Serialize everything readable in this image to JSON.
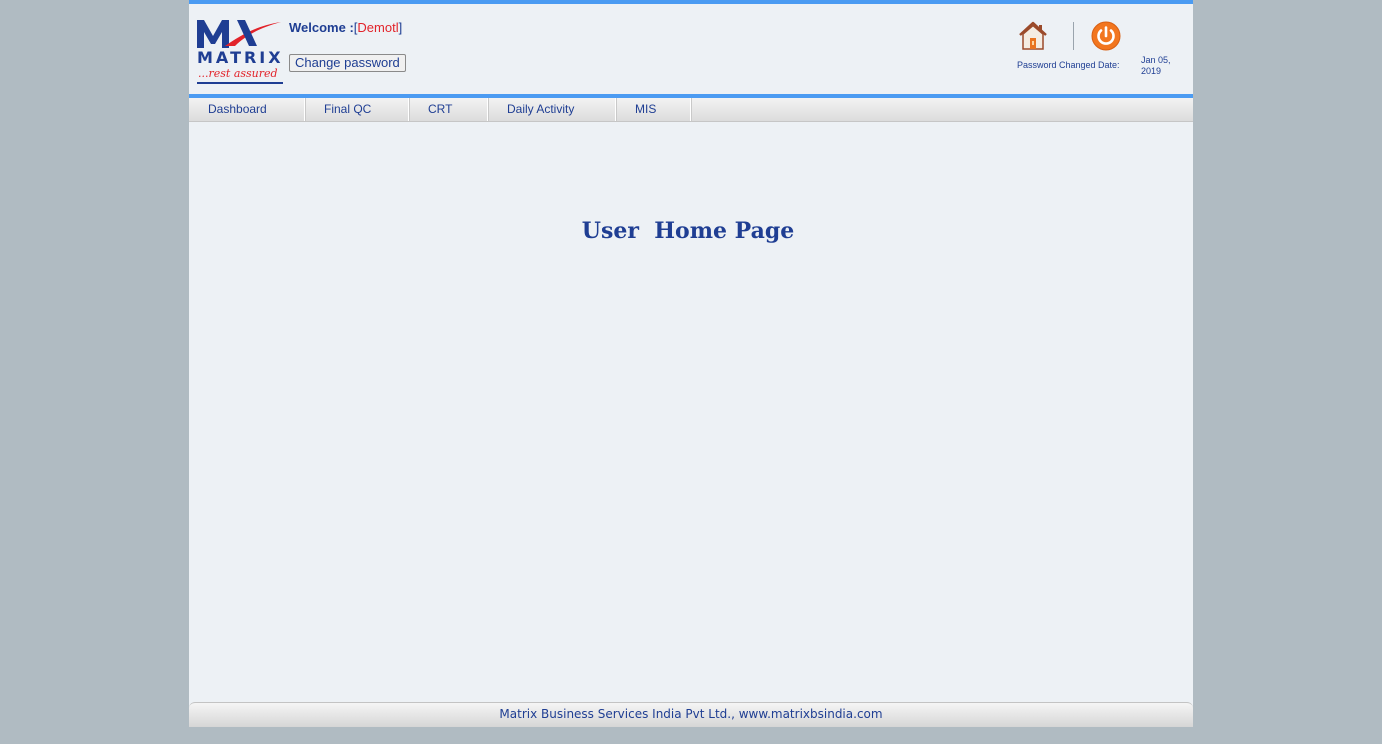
{
  "header": {
    "logo": {
      "word": "MATRIX",
      "tagline": "...rest assured"
    },
    "welcome_prefix": "Welcome :",
    "bracket_open": "[",
    "bracket_close": "]",
    "username": "Demotl",
    "change_password_label": "Change password",
    "password_changed_label": "Password Changed Date:",
    "password_changed_date": "Jan 05, 2019",
    "icons": {
      "home": "home-icon",
      "power": "power-icon"
    }
  },
  "nav": {
    "items": [
      {
        "label": "Dashboard"
      },
      {
        "label": "Final QC"
      },
      {
        "label": "CRT"
      },
      {
        "label": "Daily Activity"
      },
      {
        "label": "MIS"
      }
    ]
  },
  "main": {
    "title": "User  Home Page"
  },
  "footer": {
    "text": "Matrix Business Services India Pvt Ltd., www.matrixbsindia.com"
  },
  "colors": {
    "accent_blue": "#4b9bf2",
    "brand_navy": "#1f3e93",
    "brand_red": "#e2232a",
    "power_orange": "#f2761f",
    "background": "#b0bbc2",
    "panel": "#edf1f5"
  }
}
